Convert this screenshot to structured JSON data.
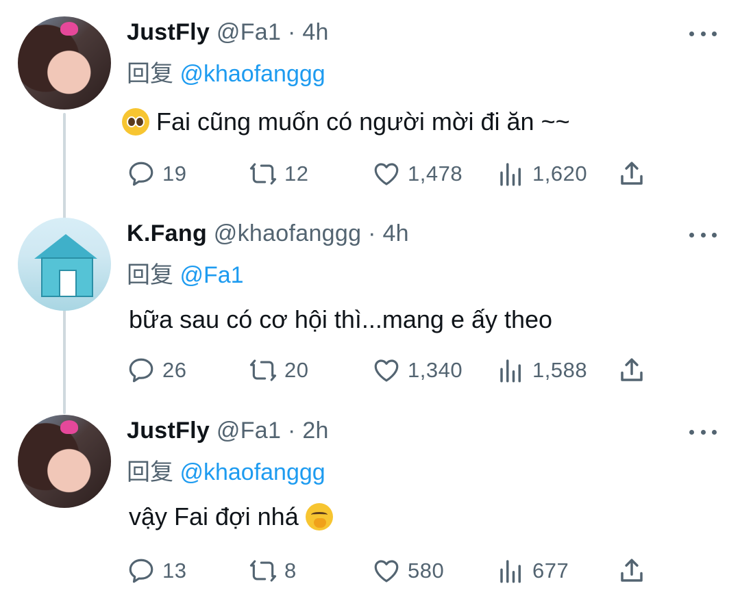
{
  "reply_label": "回复",
  "tweets": [
    {
      "name": "JustFly",
      "handle": "@Fa1",
      "separator": "·",
      "time": "4h",
      "reply_to": "@khaofanggg",
      "text": "Fai cũng muốn có người mời đi ăn ~~",
      "emoji": "pleading-face",
      "replies": "19",
      "retweets": "12",
      "likes": "1,478",
      "views": "1,620"
    },
    {
      "name": "K.Fang",
      "handle": "@khaofanggg",
      "separator": "·",
      "time": "4h",
      "reply_to": "@Fa1",
      "text": "bữa sau có cơ hội thì...mang e ấy theo",
      "replies": "26",
      "retweets": "20",
      "likes": "1,340",
      "views": "1,588"
    },
    {
      "name": "JustFly",
      "handle": "@Fa1",
      "separator": "·",
      "time": "2h",
      "reply_to": "@khaofanggg",
      "text": "vậy Fai đợi nhá",
      "emoji": "face-with-hand-over-mouth",
      "replies": "13",
      "retweets": "8",
      "likes": "580",
      "views": "677"
    }
  ],
  "colors": {
    "text": "#0f1419",
    "secondary": "#536471",
    "link": "#1d9bf0"
  }
}
